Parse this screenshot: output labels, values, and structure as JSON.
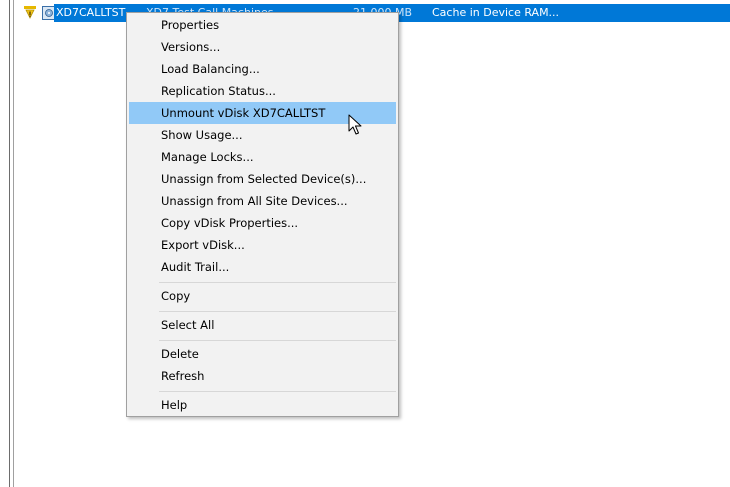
{
  "row": {
    "name": "XD7CALLTST",
    "description": "XD7 Test Call Machines",
    "size": "21,000 MB",
    "cache": "Cache in Device RAM..."
  },
  "menu": {
    "items": [
      {
        "label": "Properties"
      },
      {
        "label": "Versions..."
      },
      {
        "label": "Load Balancing..."
      },
      {
        "label": "Replication Status..."
      },
      {
        "label": "Unmount vDisk XD7CALLTST"
      },
      {
        "label": "Show Usage..."
      },
      {
        "label": "Manage Locks..."
      },
      {
        "label": "Unassign from Selected Device(s)..."
      },
      {
        "label": "Unassign from All Site Devices..."
      },
      {
        "label": "Copy vDisk Properties..."
      },
      {
        "label": "Export vDisk..."
      },
      {
        "label": "Audit Trail..."
      },
      {
        "label": "Copy"
      },
      {
        "label": "Select All"
      },
      {
        "label": "Delete"
      },
      {
        "label": "Refresh"
      },
      {
        "label": "Help"
      }
    ],
    "hovered": "Unmount vDisk XD7CALLTST"
  },
  "colors": {
    "selection": "#0078d7",
    "menu_background": "#f2f2f2",
    "menu_hover": "#91c9f7"
  },
  "icons": {
    "row_status": "warning-icon",
    "row_type": "vdisk-icon",
    "cursor": "mouse-pointer-icon"
  }
}
